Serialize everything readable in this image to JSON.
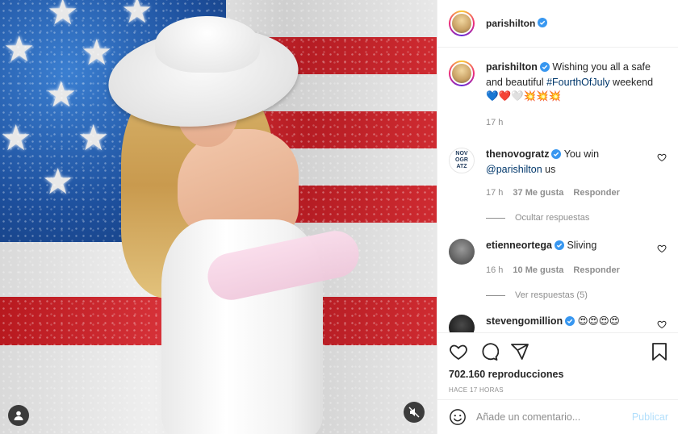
{
  "post": {
    "author": "parishilton",
    "caption_text": "Wishing you all a safe and beautiful ",
    "caption_hashtag": "#FourthOfJuly",
    "caption_tail": " weekend",
    "caption_emojis": "💙❤️🤍💥💥💥",
    "time": "17 h"
  },
  "comments": [
    {
      "user": "thenovogratz",
      "text": "You win ",
      "mention": "@parishilton",
      "text_after": " us",
      "time": "17 h",
      "likes": "37 Me gusta",
      "reply": "Responder",
      "replies_toggle": "Ocultar respuestas"
    },
    {
      "user": "etienneortega",
      "text": "Sliving",
      "time": "16 h",
      "likes": "10 Me gusta",
      "reply": "Responder",
      "replies_toggle": "Ver respuestas (5)"
    },
    {
      "user": "stevengomillion",
      "text": "😍😍😍😍"
    }
  ],
  "actions": {
    "views": "702.160 reproducciones",
    "posted": "HACE 17 HORAS"
  },
  "composer": {
    "placeholder": "Añade un comentario...",
    "publish": "Publicar"
  },
  "icons": {
    "like": "heart-icon",
    "comment": "comment-icon",
    "share": "share-icon",
    "save": "bookmark-icon",
    "emoji": "emoji-icon",
    "user_tag": "user-tag-icon",
    "mute": "mute-icon",
    "verified": "verified-badge-icon"
  },
  "colors": {
    "verified": "#3897f0",
    "link": "#00376b",
    "muted": "#8e8e8e",
    "publish_disabled": "#b2dffc"
  }
}
